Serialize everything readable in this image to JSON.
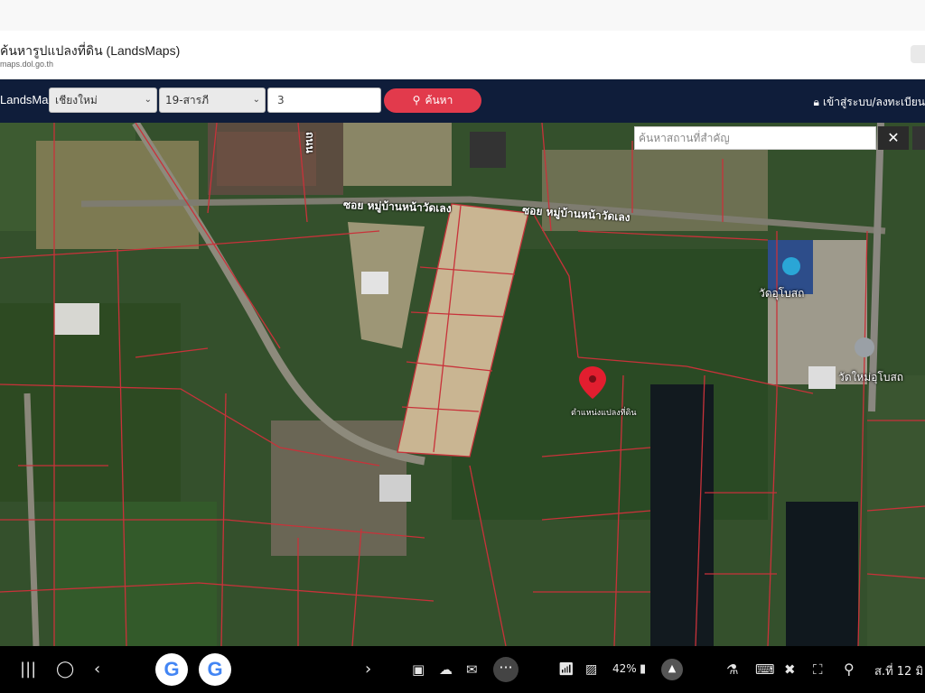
{
  "browser": {
    "tab_title": "ค้นหารูปแปลงที่ดิน (LandsMaps)",
    "tab_url": "maps.dol.go.th"
  },
  "navbar": {
    "brand": "LandsMaps",
    "province": "เชียงใหม่",
    "district": "19-สารภี",
    "parcel_number": "3",
    "search_label": "ค้นหา",
    "login_label": "เข้าสู่ระบบ/ลงทะเบียน"
  },
  "map": {
    "place_search_placeholder": "ค้นหาสถานที่สำคัญ",
    "road_label_1": "ซอย หมู่บ้านหน้าวัดเลง",
    "road_label_2": "ซอย หมู่บ้านหน้าวัดเลง",
    "road_label_vertical": "ถนน",
    "temple_1": "วัดอุโบสถ",
    "temple_2": "วัดใหม่อุโบสถ",
    "marker_label": "ตำแหน่งแปลงที่ดิน",
    "parcel_line_color": "#c8323a"
  },
  "system_bar": {
    "battery": "42%",
    "clock": "ส.ที่ 12 มิ"
  }
}
